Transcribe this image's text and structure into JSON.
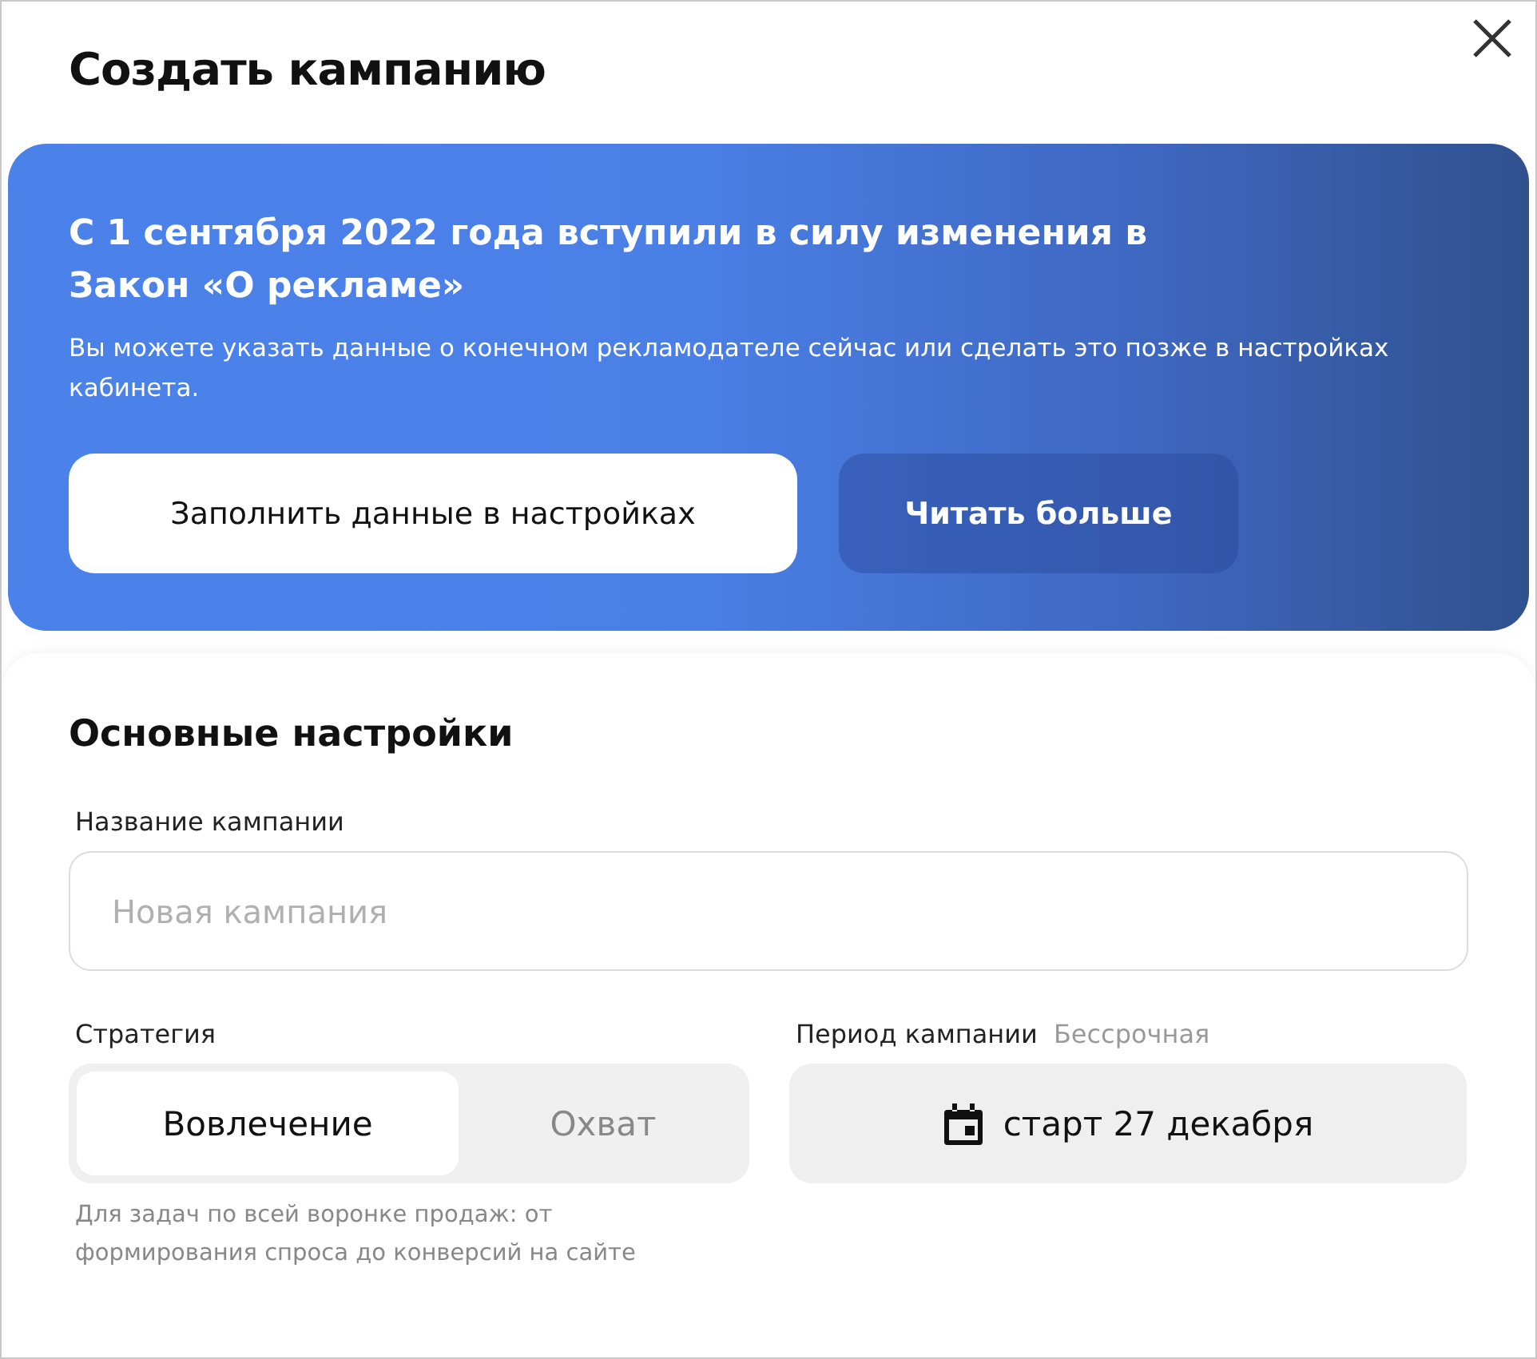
{
  "dialog": {
    "title": "Создать кампанию"
  },
  "banner": {
    "heading": "С 1 сентября 2022 года вступили в силу изменения в Закон «О рекламе»",
    "text": "Вы можете указать данные о конечном рекламодателе сейчас или сделать это позже в настройках кабинета.",
    "buttons": [
      {
        "label": "Заполнить данные в настройках",
        "kind": "primary"
      },
      {
        "label": "Читать больше",
        "kind": "secondary"
      }
    ]
  },
  "settings": {
    "title": "Основные настройки",
    "name_field": {
      "label": "Название кампании",
      "placeholder": "Новая кампания"
    },
    "strategy": {
      "label": "Стратегия",
      "options": [
        {
          "label": "Вовлечение",
          "selected": true
        },
        {
          "label": "Охват",
          "selected": false
        }
      ],
      "hint": "Для задач по всей воронке продаж: от формирования спроса до конверсий на сайте"
    },
    "period": {
      "label": "Период кампании",
      "value_note": "Бессрочная",
      "button": "старт 27 декабря"
    }
  }
}
